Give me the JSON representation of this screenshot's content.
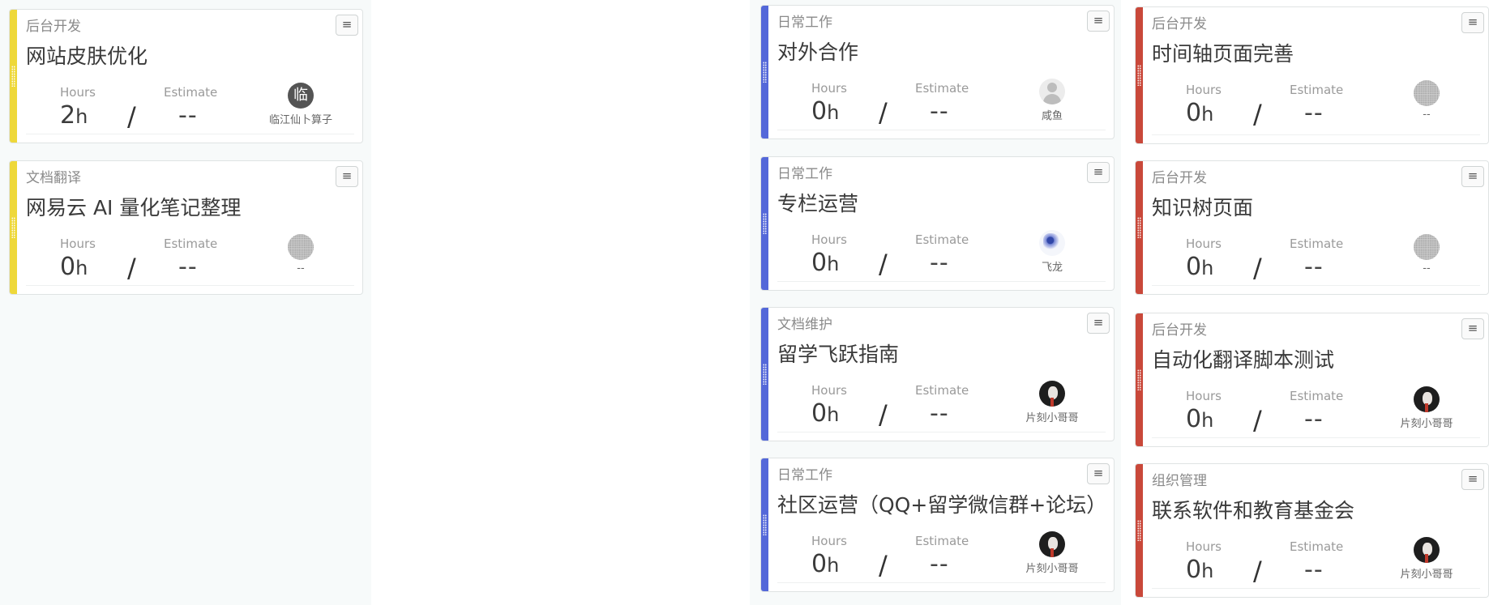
{
  "labels": {
    "hours": "Hours",
    "estimate": "Estimate",
    "hours_unit": "h",
    "slash": "/",
    "menu_icon": "≡"
  },
  "colors": {
    "yellow": "#eed83a",
    "blue": "#5468d9",
    "red": "#c9483a"
  },
  "columns": [
    {
      "cards": [
        {
          "category": "后台开发",
          "title": "网站皮肤优化",
          "hours": "2",
          "estimate": "--",
          "assignee": "临江仙卜算子",
          "avatar": "letter",
          "avatar_text": "临",
          "stripe": "yellow"
        },
        {
          "category": "文档翻译",
          "title": "网易云 AI 量化笔记整理",
          "hours": "0",
          "estimate": "--",
          "assignee": "--",
          "avatar": "dither",
          "avatar_text": "",
          "stripe": "yellow"
        }
      ]
    },
    {
      "cards": [
        {
          "category": "日常工作",
          "title": "对外合作",
          "hours": "0",
          "estimate": "--",
          "assignee": "咸鱼",
          "avatar": "person",
          "avatar_text": "",
          "stripe": "blue"
        },
        {
          "category": "日常工作",
          "title": "专栏运营",
          "hours": "0",
          "estimate": "--",
          "assignee": "飞龙",
          "avatar": "dragon",
          "avatar_text": "",
          "stripe": "blue"
        },
        {
          "category": "文档维护",
          "title": "留学飞跃指南",
          "hours": "0",
          "estimate": "--",
          "assignee": "片刻小哥哥",
          "avatar": "photo",
          "avatar_text": "",
          "stripe": "blue"
        },
        {
          "category": "日常工作",
          "title": "社区运营（QQ+留学微信群+论坛）",
          "hours": "0",
          "estimate": "--",
          "assignee": "片刻小哥哥",
          "avatar": "photo",
          "avatar_text": "",
          "stripe": "blue"
        }
      ]
    },
    {
      "cards": [
        {
          "category": "后台开发",
          "title": "时间轴页面完善",
          "hours": "0",
          "estimate": "--",
          "assignee": "--",
          "avatar": "dither",
          "avatar_text": "",
          "stripe": "red"
        },
        {
          "category": "后台开发",
          "title": "知识树页面",
          "hours": "0",
          "estimate": "--",
          "assignee": "--",
          "avatar": "dither",
          "avatar_text": "",
          "stripe": "red"
        },
        {
          "category": "后台开发",
          "title": "自动化翻译脚本测试",
          "hours": "0",
          "estimate": "--",
          "assignee": "片刻小哥哥",
          "avatar": "photo",
          "avatar_text": "",
          "stripe": "red"
        },
        {
          "category": "组织管理",
          "title": "联系软件和教育基金会",
          "hours": "0",
          "estimate": "--",
          "assignee": "片刻小哥哥",
          "avatar": "photo",
          "avatar_text": "",
          "stripe": "red"
        }
      ]
    }
  ]
}
